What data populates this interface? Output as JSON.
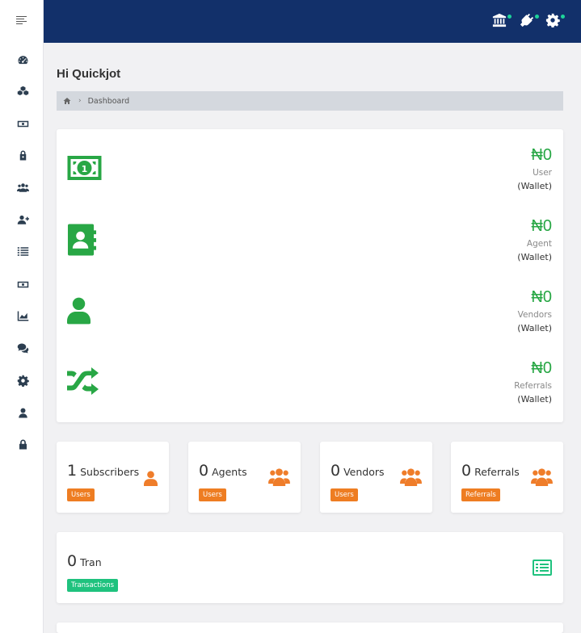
{
  "header": {
    "title": "Hi Quickjot",
    "breadcrumb": "Dashboard"
  },
  "wallets": [
    {
      "amount": "₦0",
      "name": "User",
      "sub": "(Wallet)"
    },
    {
      "amount": "₦0",
      "name": "Agent",
      "sub": "(Wallet)"
    },
    {
      "amount": "₦0",
      "name": "Vendors",
      "sub": "(Wallet)"
    },
    {
      "amount": "₦0",
      "name": "Referrals",
      "sub": "(Wallet)"
    }
  ],
  "stats": [
    {
      "value": "1",
      "label": "Subscribers",
      "badge": "Users"
    },
    {
      "value": "0",
      "label": "Agents",
      "badge": "Users"
    },
    {
      "value": "0",
      "label": "Vendors",
      "badge": "Users"
    },
    {
      "value": "0",
      "label": "Referrals",
      "badge": "Referrals"
    }
  ],
  "transactions": {
    "value": "0",
    "label": "Tran",
    "badge": "Transactions"
  },
  "colors": {
    "topbar": "#12306a",
    "green": "#28a745",
    "orange": "#ee7d22",
    "badge_green": "#1fc27e"
  },
  "icons": {
    "sidebar": [
      "dashboard-icon",
      "cubes-icon",
      "money-bill-icon",
      "lock-user-icon",
      "users-icon",
      "user-plus-icon",
      "list-icon",
      "money-bill-alt-icon",
      "chart-area-icon",
      "chat-icon",
      "gear-icon",
      "user-icon",
      "lock-icon"
    ],
    "topbar": [
      "bank-icon",
      "plug-icon",
      "gears-icon"
    ]
  }
}
